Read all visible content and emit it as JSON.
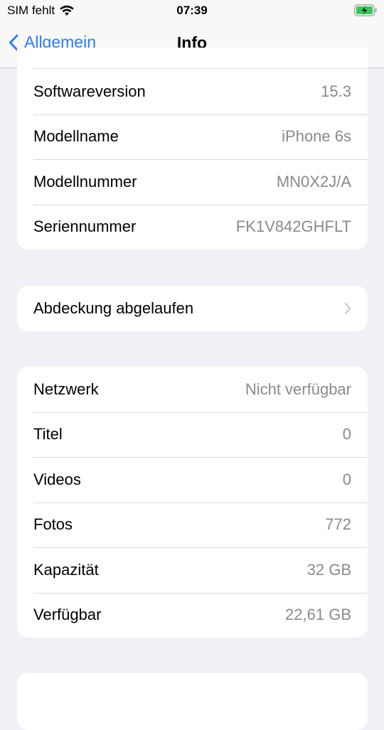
{
  "status_bar": {
    "carrier": "SIM fehlt",
    "time": "07:39",
    "icons": [
      "wifi-icon",
      "battery-charging-icon"
    ],
    "battery_color": "#34c759"
  },
  "nav": {
    "back_label": "Allgemein",
    "title": "Info",
    "accent_color": "#2f7cf6"
  },
  "groups": [
    {
      "rows": [
        {
          "label": "Softwareversion",
          "value": "15.3"
        },
        {
          "label": "Modellname",
          "value": "iPhone 6s"
        },
        {
          "label": "Modellnummer",
          "value": "MN0X2J/A"
        },
        {
          "label": "Seriennummer",
          "value": "FK1V842GHFLT"
        }
      ]
    },
    {
      "rows": [
        {
          "label": "Abdeckung abgelaufen",
          "icon": "chevron-right-icon"
        }
      ]
    },
    {
      "rows": [
        {
          "label": "Netzwerk",
          "value": "Nicht verfügbar"
        },
        {
          "label": "Titel",
          "value": "0"
        },
        {
          "label": "Videos",
          "value": "0"
        },
        {
          "label": "Fotos",
          "value": "772"
        },
        {
          "label": "Kapazität",
          "value": "32 GB"
        },
        {
          "label": "Verfügbar",
          "value": "22,61 GB"
        }
      ]
    }
  ]
}
